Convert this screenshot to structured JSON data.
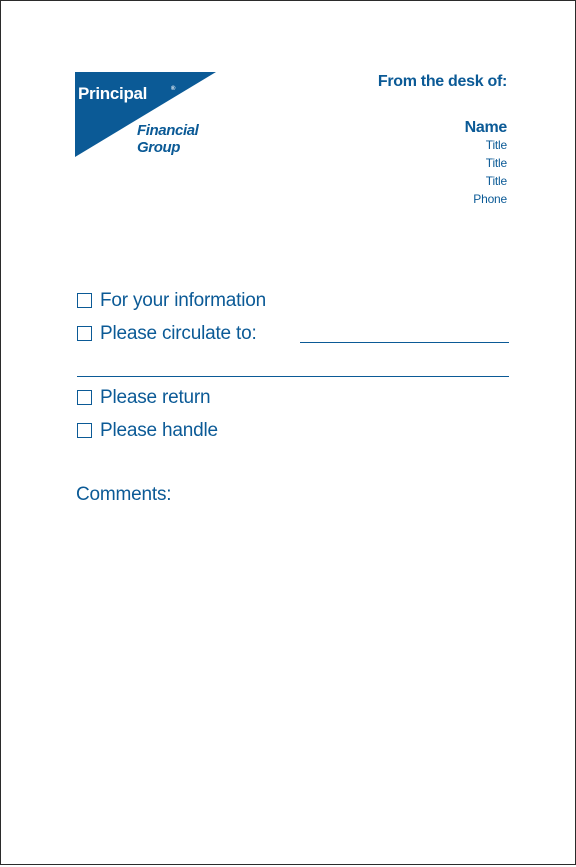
{
  "logo": {
    "principal": "Principal",
    "registered": "®",
    "financial": "Financial",
    "group": "Group"
  },
  "header": {
    "from_desk": "From the desk of:"
  },
  "sender": {
    "name": "Name",
    "title1": "Title",
    "title2": "Title",
    "title3": "Title",
    "phone": "Phone"
  },
  "checklist": {
    "item1": "For your information",
    "item2": "Please circulate to:",
    "item3": "Please return",
    "item4": "Please handle"
  },
  "comments_label": "Comments:",
  "colors": {
    "brand_blue": "#0b5a96",
    "border": "#2b2b2b"
  }
}
